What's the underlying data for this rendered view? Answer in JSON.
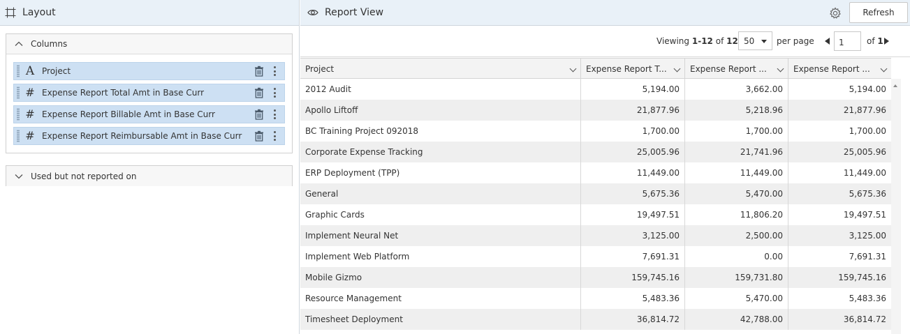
{
  "layout_panel": {
    "title": "Layout",
    "columns_section": {
      "label": "Columns",
      "items": [
        {
          "type_icon": "A",
          "name": "Project"
        },
        {
          "type_icon": "#",
          "name": "Expense Report Total Amt in Base Curr"
        },
        {
          "type_icon": "#",
          "name": "Expense Report Billable Amt in Base Curr"
        },
        {
          "type_icon": "#",
          "name": "Expense Report Reimbursable Amt in Base Curr"
        }
      ]
    },
    "used_section": {
      "label": "Used but not reported on"
    }
  },
  "report_panel": {
    "title": "Report View",
    "refresh_label": "Refresh",
    "pager": {
      "viewing_prefix": "Viewing",
      "viewing_range": "1-12",
      "viewing_of": "of",
      "viewing_total": "12",
      "per_page_value": "50",
      "per_page_label": "per page",
      "page_value": "1",
      "of_label": "of",
      "page_count": "1"
    },
    "table": {
      "headers": [
        "Project",
        "Expense Report T...",
        "Expense Report ...",
        "Expense Report ..."
      ],
      "rows": [
        [
          "2012 Audit",
          "5,194.00",
          "3,662.00",
          "5,194.00"
        ],
        [
          "Apollo Liftoff",
          "21,877.96",
          "5,218.96",
          "21,877.96"
        ],
        [
          "BC Training Project 092018",
          "1,700.00",
          "1,700.00",
          "1,700.00"
        ],
        [
          "Corporate Expense Tracking",
          "25,005.96",
          "21,741.96",
          "25,005.96"
        ],
        [
          "ERP Deployment (TPP)",
          "11,449.00",
          "11,449.00",
          "11,449.00"
        ],
        [
          "General",
          "5,675.36",
          "5,470.00",
          "5,675.36"
        ],
        [
          "Graphic Cards",
          "19,497.51",
          "11,806.20",
          "19,497.51"
        ],
        [
          "Implement Neural Net",
          "3,125.00",
          "2,500.00",
          "3,125.00"
        ],
        [
          "Implement Web Platform",
          "7,691.31",
          "0.00",
          "7,691.31"
        ],
        [
          "Mobile Gizmo",
          "159,745.16",
          "159,731.80",
          "159,745.16"
        ],
        [
          "Resource Management",
          "5,483.36",
          "5,470.00",
          "5,483.36"
        ],
        [
          "Timesheet Deployment",
          "36,814.72",
          "42,788.00",
          "36,814.72"
        ]
      ]
    }
  },
  "icons": {
    "layout": "layout-frame-icon",
    "report": "eye-icon",
    "settings": "gear-icon",
    "collapse": "chevron-up-icon",
    "expand": "chevron-down-icon",
    "delete": "trash-icon",
    "more": "more-vertical-icon",
    "drag": "drag-handle-icon"
  },
  "colors": {
    "header_bg": "#e9f1f8",
    "column_item_bg": "#cde0f3",
    "alt_row_bg": "#efefef"
  }
}
